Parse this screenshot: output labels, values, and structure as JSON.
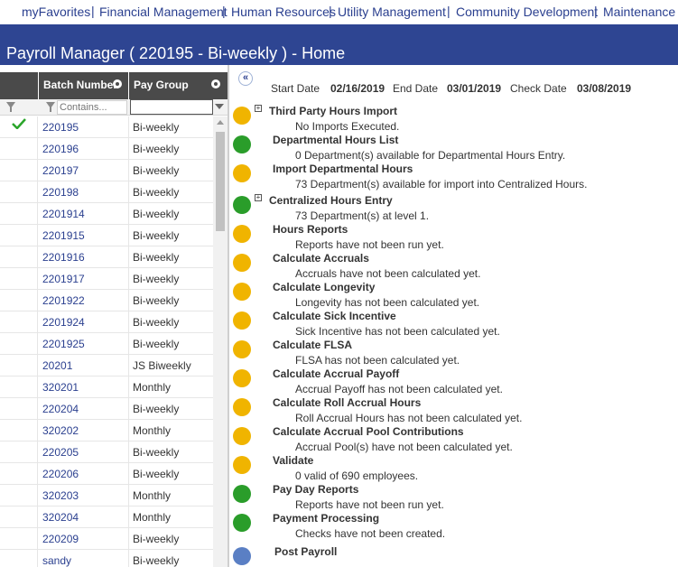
{
  "topnav": {
    "items": [
      "myFavorites",
      "Financial Management",
      "Human Resources",
      "Utility Management",
      "Community Development",
      "Maintenance"
    ]
  },
  "title": "Payroll Manager ( 220195 - Bi-weekly ) - Home",
  "grid": {
    "columns": [
      "Batch Number",
      "Pay Group"
    ],
    "filter_placeholder": "Contains...",
    "rows": [
      {
        "batch": "220195",
        "group": "Bi-weekly",
        "checked": true
      },
      {
        "batch": "220196",
        "group": "Bi-weekly"
      },
      {
        "batch": "220197",
        "group": "Bi-weekly"
      },
      {
        "batch": "220198",
        "group": "Bi-weekly"
      },
      {
        "batch": "2201914",
        "group": "Bi-weekly"
      },
      {
        "batch": "2201915",
        "group": "Bi-weekly"
      },
      {
        "batch": "2201916",
        "group": "Bi-weekly"
      },
      {
        "batch": "2201917",
        "group": "Bi-weekly"
      },
      {
        "batch": "2201922",
        "group": "Bi-weekly"
      },
      {
        "batch": "2201924",
        "group": "Bi-weekly"
      },
      {
        "batch": "2201925",
        "group": "Bi-weekly"
      },
      {
        "batch": "20201",
        "group": "JS Biweekly"
      },
      {
        "batch": "320201",
        "group": "Monthly"
      },
      {
        "batch": "220204",
        "group": "Bi-weekly"
      },
      {
        "batch": "320202",
        "group": "Monthly"
      },
      {
        "batch": "220205",
        "group": "Bi-weekly"
      },
      {
        "batch": "220206",
        "group": "Bi-weekly"
      },
      {
        "batch": "320203",
        "group": "Monthly"
      },
      {
        "batch": "320204",
        "group": "Monthly"
      },
      {
        "batch": "220209",
        "group": "Bi-weekly"
      },
      {
        "batch": "sandy",
        "group": "Bi-weekly"
      }
    ]
  },
  "dates": {
    "start_label": "Start Date",
    "start_value": "02/16/2019",
    "end_label": "End Date",
    "end_value": "03/01/2019",
    "check_label": "Check Date",
    "check_value": "03/08/2019"
  },
  "tasks": [
    {
      "name": "Third Party Hours Import",
      "desc": "No Imports Executed.",
      "expandable": true,
      "icon": "import-clock-icon",
      "color": "#f0b400"
    },
    {
      "name": "Departmental Hours List",
      "desc": "0 Department(s) available for Departmental Hours Entry.",
      "icon": "people-list-icon",
      "color": "#2a9d2a"
    },
    {
      "name": "Import Departmental Hours",
      "desc": "73 Department(s) available for import into Centralized Hours.",
      "icon": "thumb-import-icon",
      "color": "#f0b400"
    },
    {
      "name": "Centralized Hours Entry",
      "desc": "73 Department(s) at level 1.",
      "expandable": true,
      "icon": "people-clock-icon",
      "color": "#2a9d2a"
    },
    {
      "name": "Hours Reports",
      "desc": "Reports have not been run yet.",
      "icon": "report-icon",
      "color": "#f0b400"
    },
    {
      "name": "Calculate Accruals",
      "desc": "Accruals have not been calculated yet.",
      "icon": "calculator-icon",
      "color": "#f0b400"
    },
    {
      "name": "Calculate Longevity",
      "desc": "Longevity has not been calculated yet.",
      "icon": "calculator-icon",
      "color": "#f0b400"
    },
    {
      "name": "Calculate Sick Incentive",
      "desc": "Sick Incentive has not been calculated yet.",
      "icon": "medical-calculator-icon",
      "color": "#f0b400"
    },
    {
      "name": "Calculate FLSA",
      "desc": "FLSA has not been calculated yet.",
      "icon": "calculator-icon",
      "color": "#f0b400"
    },
    {
      "name": "Calculate Accrual Payoff",
      "desc": "Accrual Payoff has not been calculated yet.",
      "icon": "calculator-clock-icon",
      "color": "#f0b400"
    },
    {
      "name": "Calculate Roll Accrual Hours",
      "desc": "Roll Accrual Hours has not been calculated yet.",
      "icon": "calculator-people-icon",
      "color": "#f0b400"
    },
    {
      "name": "Calculate Accrual Pool Contributions",
      "desc": "Accrual Pool(s) have not been calculated yet.",
      "icon": "calculator-pool-icon",
      "color": "#f0b400"
    },
    {
      "name": "Validate",
      "desc": "0 valid of 690 employees.",
      "icon": "check-icon",
      "color": "#f0b400"
    },
    {
      "name": "Pay Day Reports",
      "desc": "Reports have not been run yet.",
      "icon": "report-icon",
      "color": "#2a9d2a"
    },
    {
      "name": "Payment Processing",
      "desc": "Checks have not been created.",
      "icon": "money-icon",
      "color": "#2a9d2a"
    },
    {
      "name": "Post Payroll",
      "desc": "",
      "icon": "globe-icon",
      "color": "#5a7fc4"
    }
  ]
}
